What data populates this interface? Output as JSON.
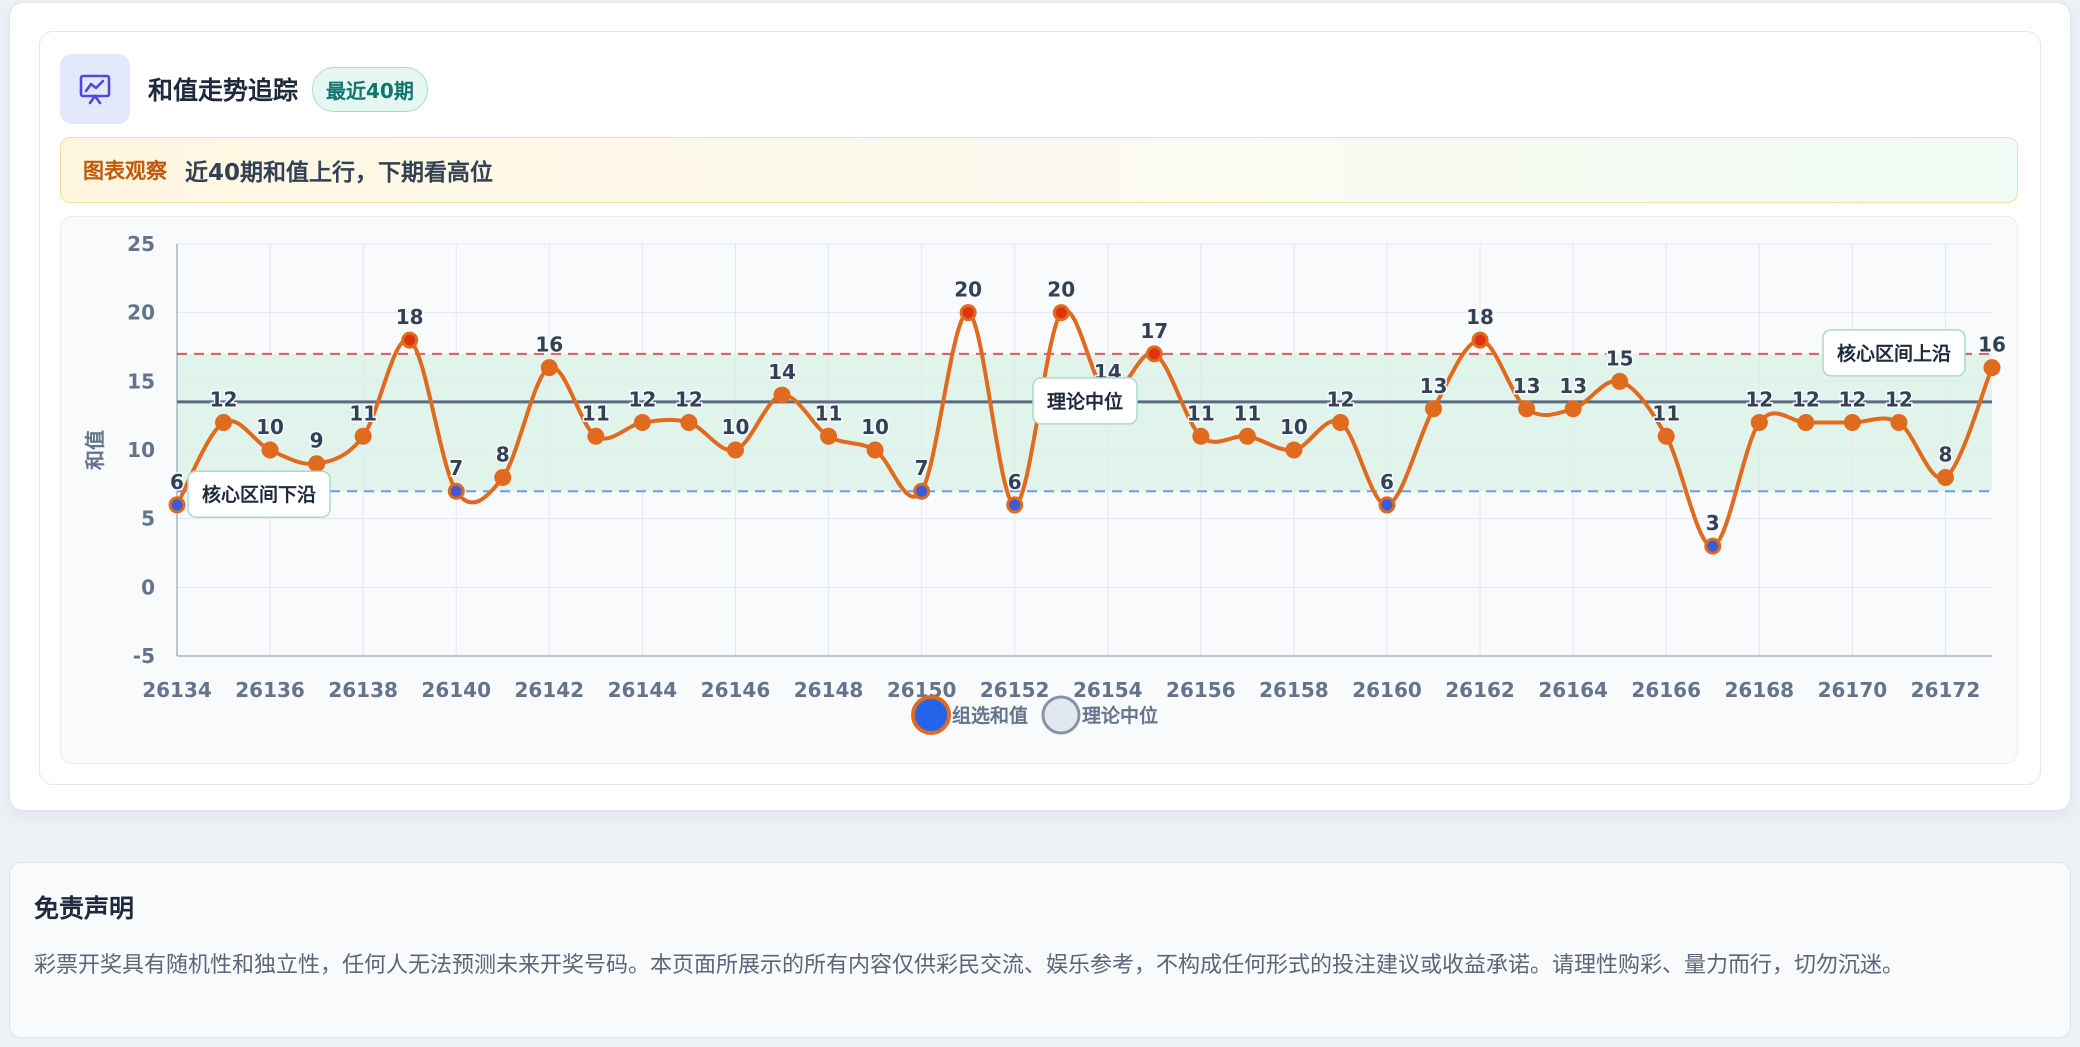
{
  "header": {
    "title": "和值走势追踪",
    "badge": "最近40期"
  },
  "insight": {
    "label": "图表观察",
    "text": "近40期和值上行，下期看高位"
  },
  "disclaimer": {
    "title": "免责声明",
    "text": "彩票开奖具有随机性和独立性，任何人无法预测未来开奖号码。本页面所展示的所有内容仅供彩民交流、娱乐参考，不构成任何形式的投注建议或收益承诺。请理性购彩、量力而行，切勿沉迷。"
  },
  "colors": {
    "series": "#e06a1e",
    "point_low": "#3b5bdb",
    "median": "#5b6b82",
    "upper": "#e05a5a",
    "lower": "#6b9cf0",
    "band": "#d9f1e7",
    "legend_primary": "#2563eb"
  },
  "chart_data": {
    "type": "line",
    "ylabel": "和值",
    "ylim": [
      -5,
      25
    ],
    "y_ticks": [
      -5,
      0,
      5,
      10,
      15,
      20,
      25
    ],
    "x": [
      26134,
      26135,
      26136,
      26137,
      26138,
      26139,
      26140,
      26141,
      26142,
      26143,
      26144,
      26145,
      26146,
      26147,
      26148,
      26149,
      26150,
      26151,
      26152,
      26153,
      26154,
      26155,
      26156,
      26157,
      26158,
      26159,
      26160,
      26161,
      26162,
      26163,
      26164,
      26165,
      26166,
      26167,
      26168,
      26169,
      26170,
      26171,
      26172,
      26173
    ],
    "x_ticks": [
      26134,
      26136,
      26138,
      26140,
      26142,
      26144,
      26146,
      26148,
      26150,
      26152,
      26154,
      26156,
      26158,
      26160,
      26162,
      26164,
      26166,
      26168,
      26170,
      26172
    ],
    "series": [
      {
        "name": "组选和值",
        "values": [
          6,
          12,
          10,
          9,
          11,
          18,
          7,
          8,
          16,
          11,
          12,
          12,
          10,
          14,
          11,
          10,
          7,
          20,
          6,
          20,
          14,
          17,
          11,
          11,
          10,
          12,
          6,
          13,
          18,
          13,
          13,
          15,
          11,
          3,
          12,
          12,
          12,
          12,
          8,
          16
        ]
      }
    ],
    "reference_lines": [
      {
        "name": "理论中位",
        "value": 13.5
      },
      {
        "name": "核心区间上沿",
        "value": 17
      },
      {
        "name": "核心区间下沿",
        "value": 7
      }
    ],
    "band": [
      7,
      17
    ],
    "legend": [
      "组选和值",
      "理论中位"
    ],
    "legend_position": "bottom-center",
    "grid": true
  }
}
